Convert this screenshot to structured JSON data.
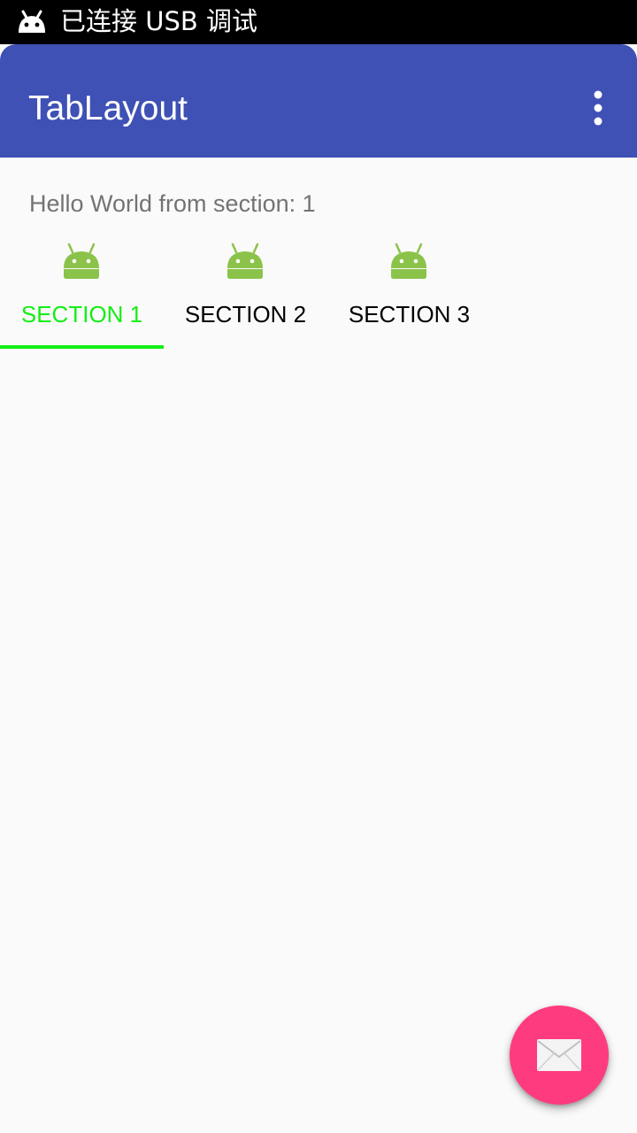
{
  "status_bar": {
    "notification_icon": "android-debug-icon",
    "text": "已连接 USB 调试"
  },
  "app_bar": {
    "title": "TabLayout",
    "overflow_icon": "more-vert-icon",
    "color": "#3f51b5"
  },
  "content": {
    "text": "Hello World from section: 1"
  },
  "tabs": [
    {
      "label": "SECTION 1",
      "icon": "android-icon",
      "selected": true
    },
    {
      "label": "SECTION 2",
      "icon": "android-icon",
      "selected": false
    },
    {
      "label": "SECTION 3",
      "icon": "android-icon",
      "selected": false
    }
  ],
  "colors": {
    "tab_selected": "#14ee14",
    "fab": "#ff3b80",
    "android_green": "#8bc34a"
  },
  "fab": {
    "icon": "mail-icon"
  }
}
